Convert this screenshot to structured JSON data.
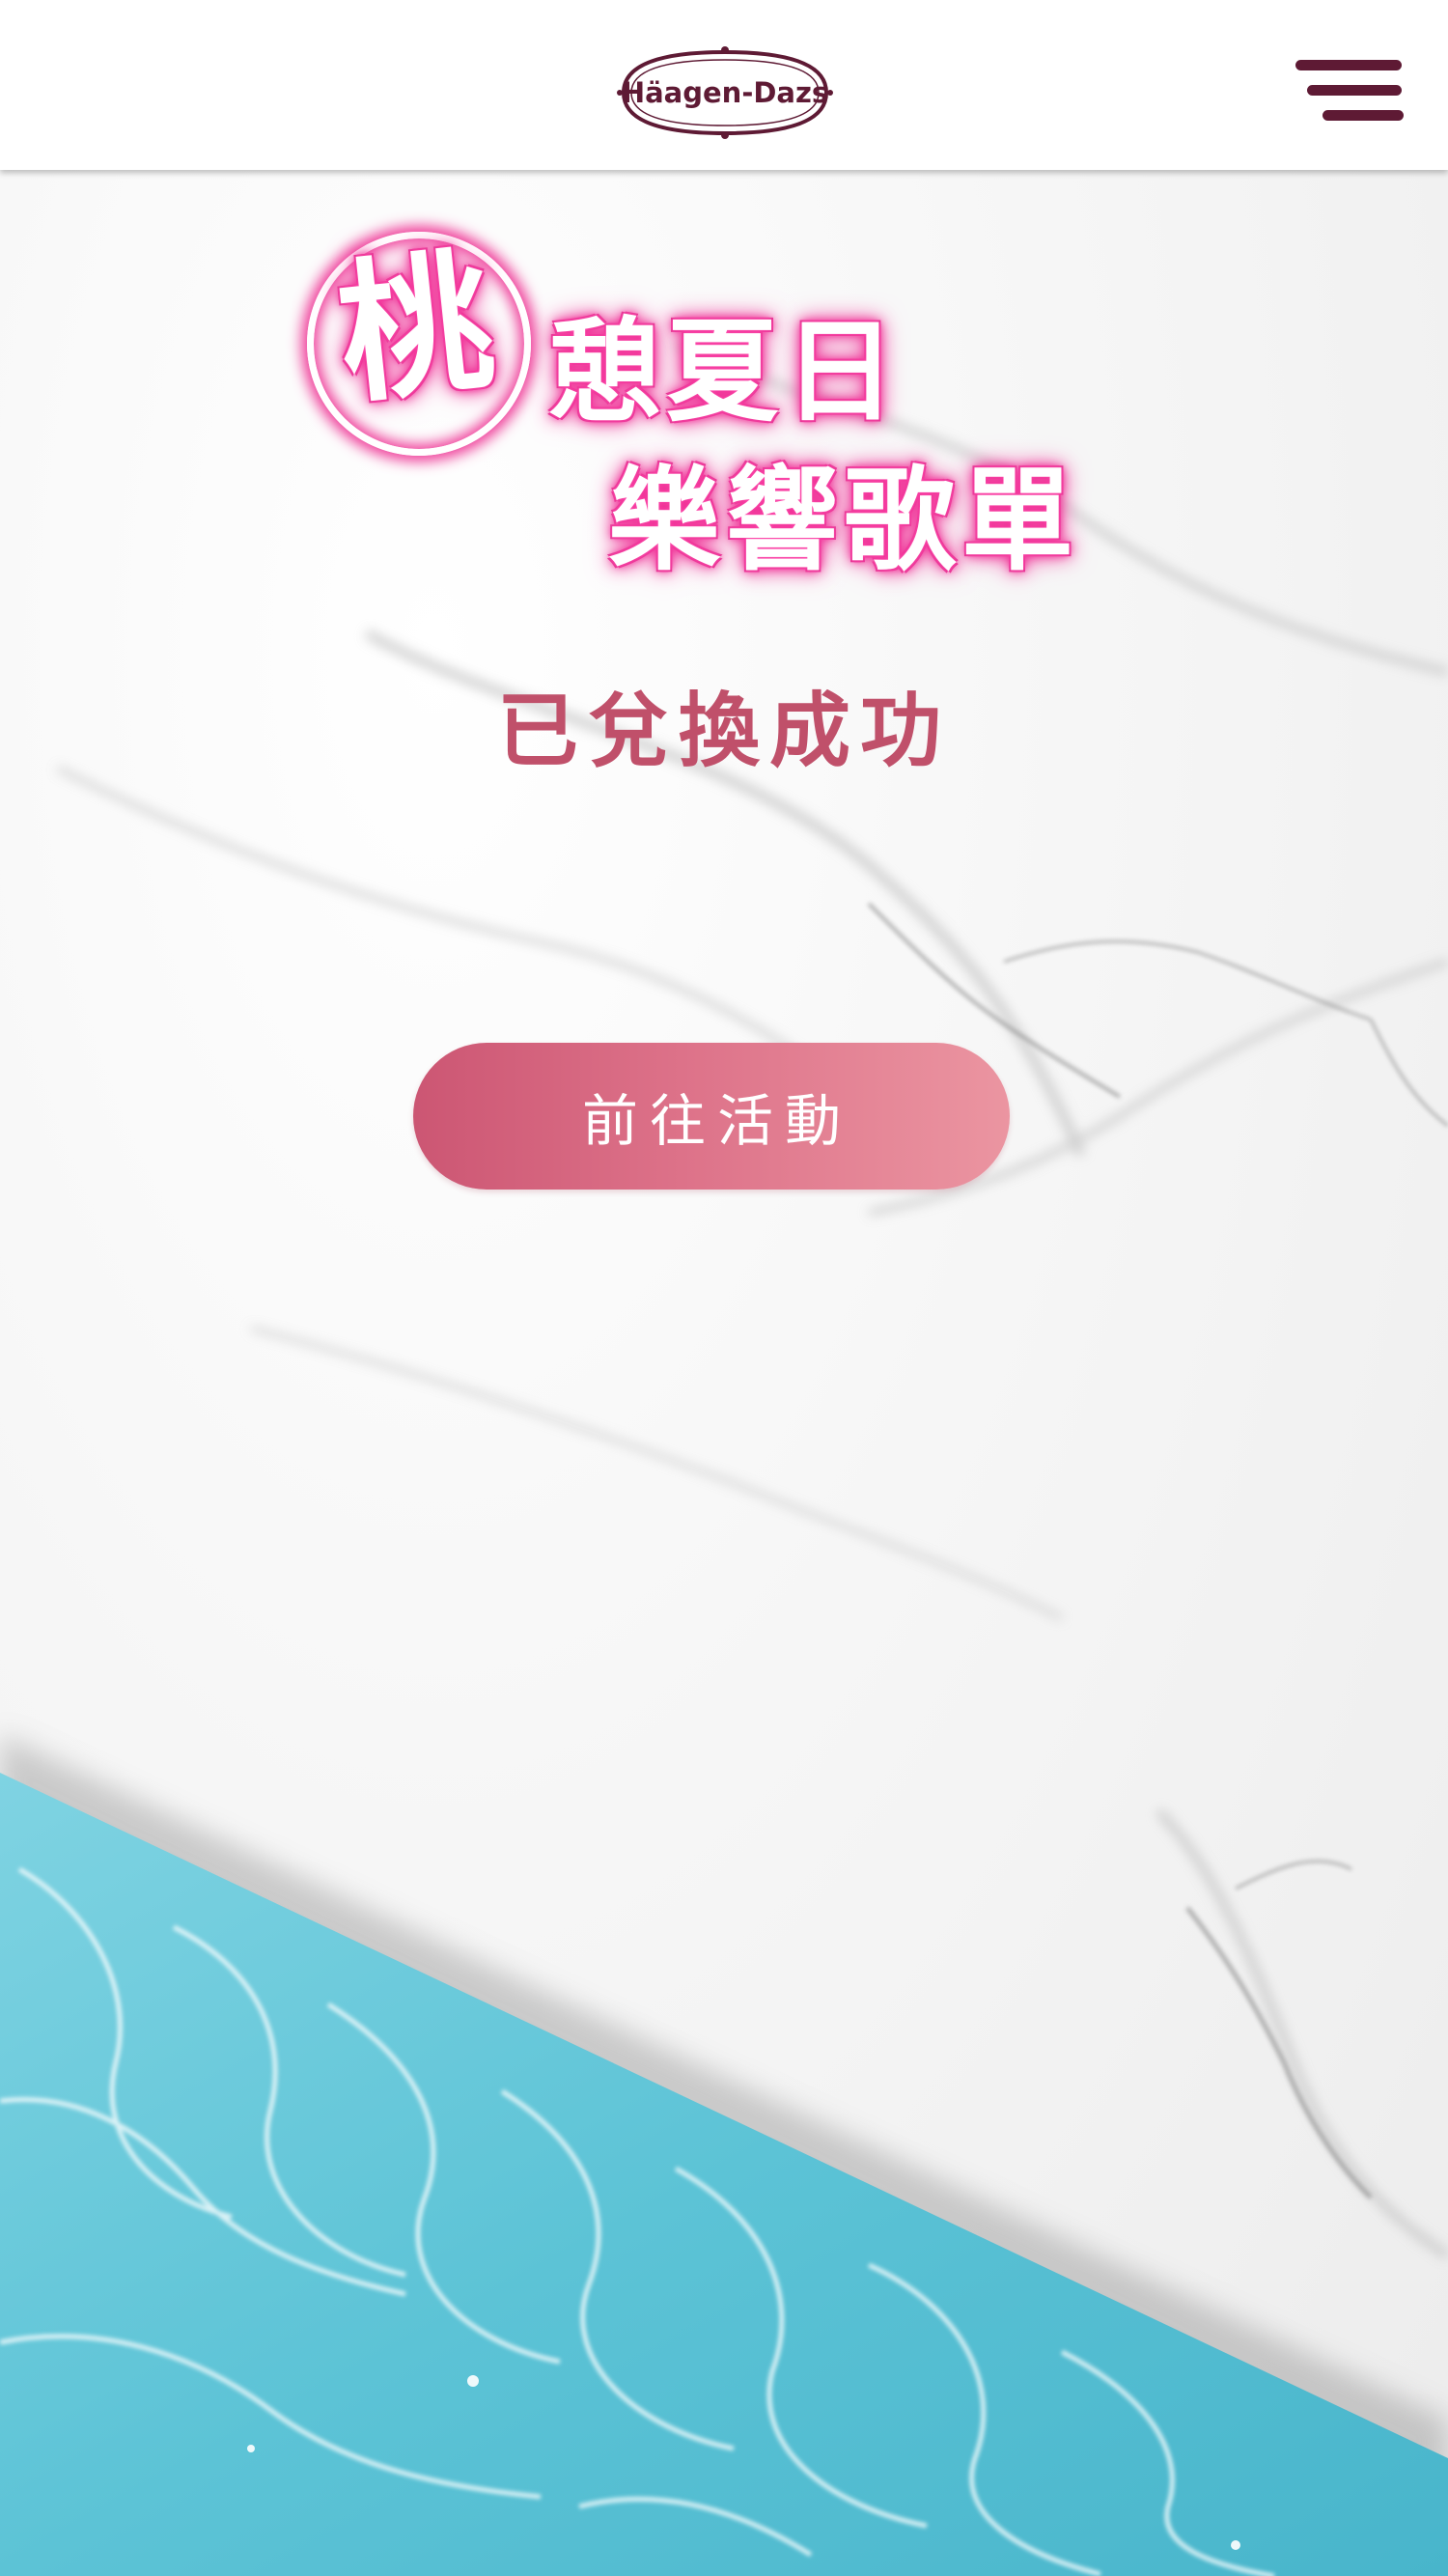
{
  "header": {
    "logo_text": "Häagen-Dazs",
    "menu_icon": "hamburger-menu-icon"
  },
  "campaign": {
    "circle_char": "桃",
    "title_line1": "憩夏日",
    "title_line2": "樂響歌單"
  },
  "status_text": "已兌換成功",
  "cta_label": "前往活動",
  "colors": {
    "brand": "#5e1a34",
    "accent": "#c0506a",
    "neon": "#ef2b93",
    "water": "#5cc3d6"
  }
}
